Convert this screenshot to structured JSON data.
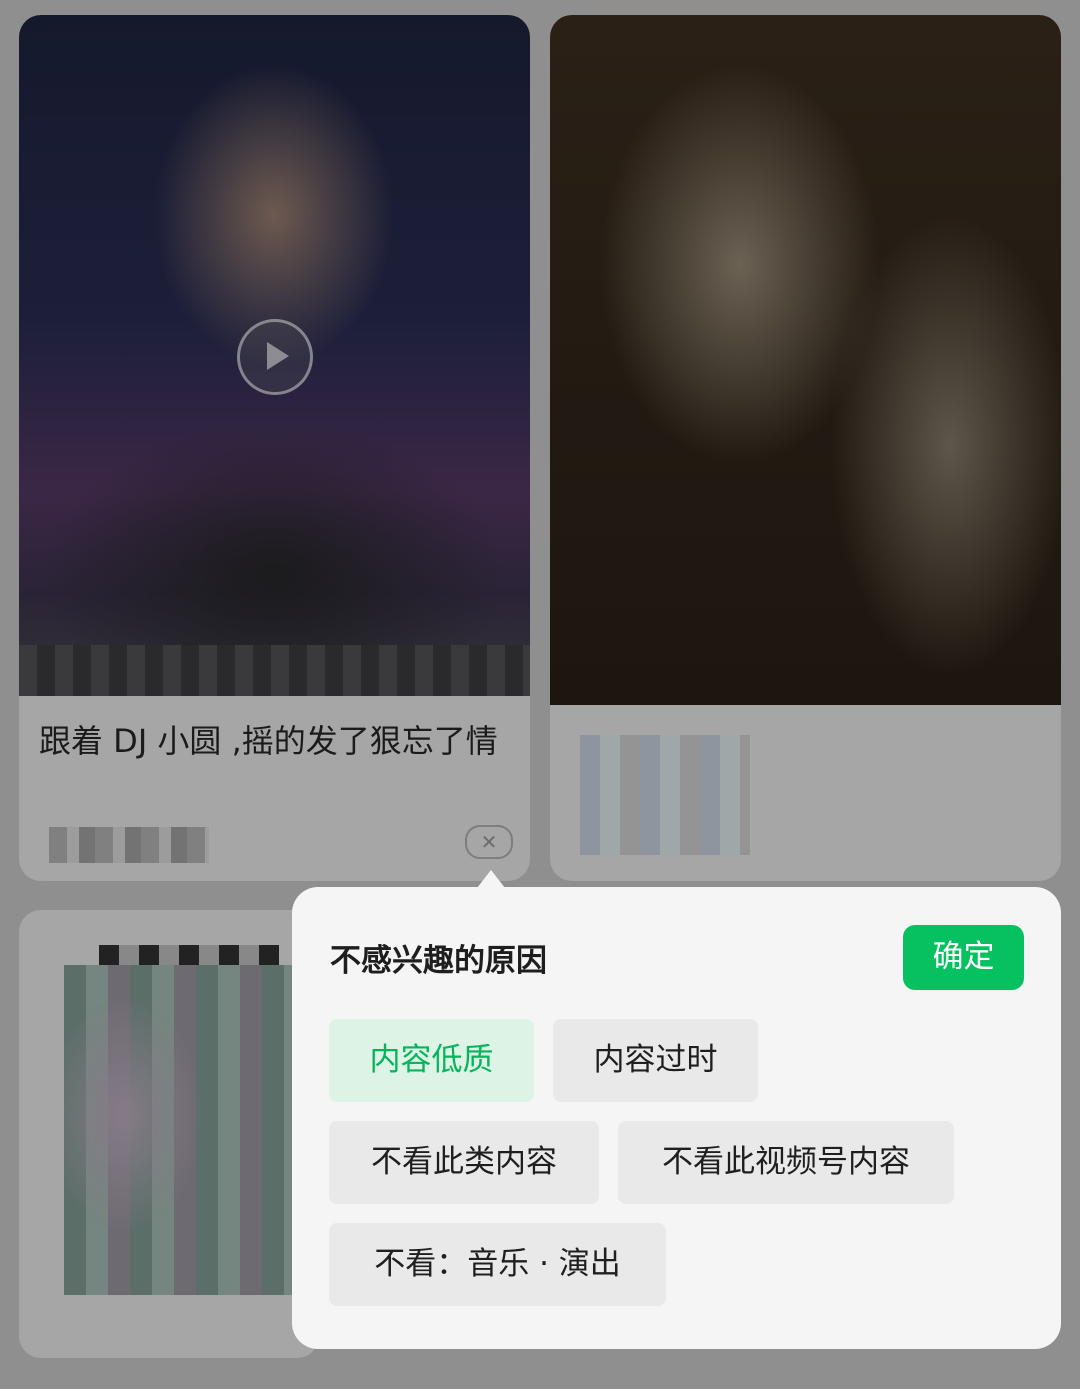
{
  "feed": {
    "card1": {
      "title": "跟着 DJ 小圆 ,摇的发了狠忘了情",
      "close_glyph": "✕",
      "play_icon": "play-circle-icon",
      "close_icon": "close-icon"
    }
  },
  "popup": {
    "title": "不感兴趣的原因",
    "confirm_label": "确定",
    "reasons": [
      {
        "label": "内容低质",
        "selected": true
      },
      {
        "label": "内容过时",
        "selected": false
      },
      {
        "label": "不看此类内容",
        "selected": false
      },
      {
        "label": "不看此视频号内容",
        "selected": false
      },
      {
        "label": "不看：音乐 · 演出",
        "selected": false
      }
    ]
  },
  "colors": {
    "accent": "#07c160",
    "selected_chip_bg": "#dcf3e6",
    "selected_chip_text": "#07b45a",
    "chip_bg": "#e9e9e9",
    "popup_bg": "#f5f5f5",
    "overlay_bg": "#8f8f8f"
  }
}
